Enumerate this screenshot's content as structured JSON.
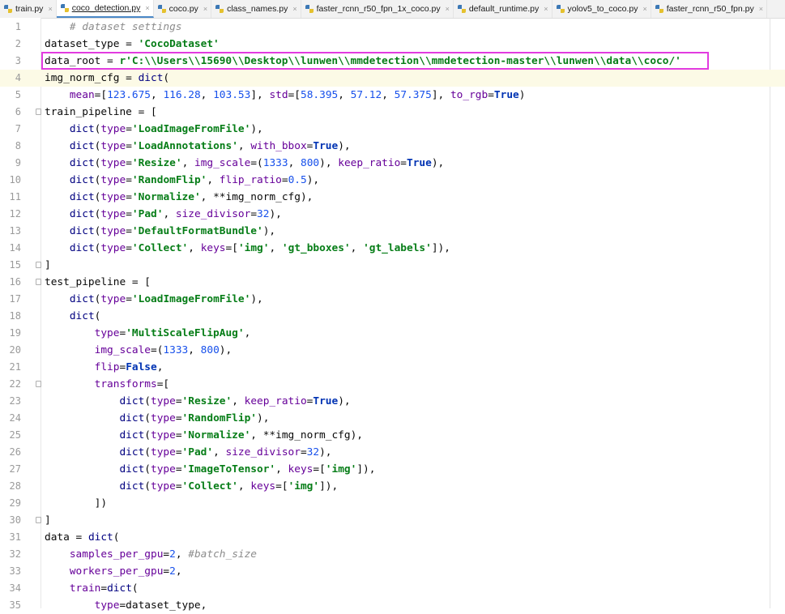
{
  "tabs": [
    {
      "label": "train.py",
      "active": false
    },
    {
      "label": "coco_detection.py",
      "active": true
    },
    {
      "label": "coco.py",
      "active": false
    },
    {
      "label": "class_names.py",
      "active": false
    },
    {
      "label": "faster_rcnn_r50_fpn_1x_coco.py",
      "active": false
    },
    {
      "label": "default_runtime.py",
      "active": false
    },
    {
      "label": "yolov5_to_coco.py",
      "active": false
    },
    {
      "label": "faster_rcnn_r50_fpn.py",
      "active": false
    }
  ],
  "tab_close_glyph": "×",
  "editor": {
    "current_line": 4,
    "highlighted_line": 3,
    "lines": [
      {
        "n": "1",
        "fold": false,
        "tokens": [
          [
            "    ",
            "plain"
          ],
          [
            "# dataset settings",
            "cm"
          ]
        ]
      },
      {
        "n": "2",
        "fold": false,
        "tokens": [
          [
            "dataset_type = ",
            "plain"
          ],
          [
            "'CocoDataset'",
            "str"
          ]
        ]
      },
      {
        "n": "3",
        "fold": false,
        "tokens": [
          [
            "data_root = ",
            "plain"
          ],
          [
            "r'C:\\\\Users\\\\15690\\\\Desktop\\\\lunwen\\\\mmdetection\\\\mmdetection-master\\\\lunwen\\\\data\\\\coco/'",
            "str"
          ]
        ]
      },
      {
        "n": "4",
        "fold": false,
        "tokens": [
          [
            "img_norm_cfg = ",
            "plain"
          ],
          [
            "dict",
            "fn"
          ],
          [
            "(",
            "plain"
          ]
        ]
      },
      {
        "n": "5",
        "fold": false,
        "tokens": [
          [
            "    ",
            "plain"
          ],
          [
            "mean",
            "kwarg"
          ],
          [
            "=[",
            "plain"
          ],
          [
            "123.675",
            "num"
          ],
          [
            ", ",
            "plain"
          ],
          [
            "116.28",
            "num"
          ],
          [
            ", ",
            "plain"
          ],
          [
            "103.53",
            "num"
          ],
          [
            "], ",
            "plain"
          ],
          [
            "std",
            "kwarg"
          ],
          [
            "=[",
            "plain"
          ],
          [
            "58.395",
            "num"
          ],
          [
            ", ",
            "plain"
          ],
          [
            "57.12",
            "num"
          ],
          [
            ", ",
            "plain"
          ],
          [
            "57.375",
            "num"
          ],
          [
            "], ",
            "plain"
          ],
          [
            "to_rgb",
            "kwarg"
          ],
          [
            "=",
            "plain"
          ],
          [
            "True",
            "kw"
          ],
          [
            ")",
            "plain"
          ]
        ]
      },
      {
        "n": "6",
        "fold": true,
        "tokens": [
          [
            "train_pipeline = [",
            "plain"
          ]
        ]
      },
      {
        "n": "7",
        "fold": false,
        "tokens": [
          [
            "    ",
            "plain"
          ],
          [
            "dict",
            "fn"
          ],
          [
            "(",
            "plain"
          ],
          [
            "type",
            "kwarg"
          ],
          [
            "=",
            "plain"
          ],
          [
            "'LoadImageFromFile'",
            "str"
          ],
          [
            "),",
            "plain"
          ]
        ]
      },
      {
        "n": "8",
        "fold": false,
        "tokens": [
          [
            "    ",
            "plain"
          ],
          [
            "dict",
            "fn"
          ],
          [
            "(",
            "plain"
          ],
          [
            "type",
            "kwarg"
          ],
          [
            "=",
            "plain"
          ],
          [
            "'LoadAnnotations'",
            "str"
          ],
          [
            ", ",
            "plain"
          ],
          [
            "with_bbox",
            "kwarg"
          ],
          [
            "=",
            "plain"
          ],
          [
            "True",
            "kw"
          ],
          [
            "),",
            "plain"
          ]
        ]
      },
      {
        "n": "9",
        "fold": false,
        "tokens": [
          [
            "    ",
            "plain"
          ],
          [
            "dict",
            "fn"
          ],
          [
            "(",
            "plain"
          ],
          [
            "type",
            "kwarg"
          ],
          [
            "=",
            "plain"
          ],
          [
            "'Resize'",
            "str"
          ],
          [
            ", ",
            "plain"
          ],
          [
            "img_scale",
            "kwarg"
          ],
          [
            "=(",
            "plain"
          ],
          [
            "1333",
            "num"
          ],
          [
            ", ",
            "plain"
          ],
          [
            "800",
            "num"
          ],
          [
            "), ",
            "plain"
          ],
          [
            "keep_ratio",
            "kwarg"
          ],
          [
            "=",
            "plain"
          ],
          [
            "True",
            "kw"
          ],
          [
            "),",
            "plain"
          ]
        ]
      },
      {
        "n": "10",
        "fold": false,
        "tokens": [
          [
            "    ",
            "plain"
          ],
          [
            "dict",
            "fn"
          ],
          [
            "(",
            "plain"
          ],
          [
            "type",
            "kwarg"
          ],
          [
            "=",
            "plain"
          ],
          [
            "'RandomFlip'",
            "str"
          ],
          [
            ", ",
            "plain"
          ],
          [
            "flip_ratio",
            "kwarg"
          ],
          [
            "=",
            "plain"
          ],
          [
            "0.5",
            "num"
          ],
          [
            "),",
            "plain"
          ]
        ]
      },
      {
        "n": "11",
        "fold": false,
        "tokens": [
          [
            "    ",
            "plain"
          ],
          [
            "dict",
            "fn"
          ],
          [
            "(",
            "plain"
          ],
          [
            "type",
            "kwarg"
          ],
          [
            "=",
            "plain"
          ],
          [
            "'Normalize'",
            "str"
          ],
          [
            ", **img_norm_cfg),",
            "plain"
          ]
        ]
      },
      {
        "n": "12",
        "fold": false,
        "tokens": [
          [
            "    ",
            "plain"
          ],
          [
            "dict",
            "fn"
          ],
          [
            "(",
            "plain"
          ],
          [
            "type",
            "kwarg"
          ],
          [
            "=",
            "plain"
          ],
          [
            "'Pad'",
            "str"
          ],
          [
            ", ",
            "plain"
          ],
          [
            "size_divisor",
            "kwarg"
          ],
          [
            "=",
            "plain"
          ],
          [
            "32",
            "num"
          ],
          [
            "),",
            "plain"
          ]
        ]
      },
      {
        "n": "13",
        "fold": false,
        "tokens": [
          [
            "    ",
            "plain"
          ],
          [
            "dict",
            "fn"
          ],
          [
            "(",
            "plain"
          ],
          [
            "type",
            "kwarg"
          ],
          [
            "=",
            "plain"
          ],
          [
            "'DefaultFormatBundle'",
            "str"
          ],
          [
            "),",
            "plain"
          ]
        ]
      },
      {
        "n": "14",
        "fold": false,
        "tokens": [
          [
            "    ",
            "plain"
          ],
          [
            "dict",
            "fn"
          ],
          [
            "(",
            "plain"
          ],
          [
            "type",
            "kwarg"
          ],
          [
            "=",
            "plain"
          ],
          [
            "'Collect'",
            "str"
          ],
          [
            ", ",
            "plain"
          ],
          [
            "keys",
            "kwarg"
          ],
          [
            "=[",
            "plain"
          ],
          [
            "'img'",
            "str"
          ],
          [
            ", ",
            "plain"
          ],
          [
            "'gt_bboxes'",
            "str"
          ],
          [
            ", ",
            "plain"
          ],
          [
            "'gt_labels'",
            "str"
          ],
          [
            "]),",
            "plain"
          ]
        ]
      },
      {
        "n": "15",
        "fold": true,
        "tokens": [
          [
            "]",
            "plain"
          ]
        ]
      },
      {
        "n": "16",
        "fold": true,
        "tokens": [
          [
            "test_pipeline = [",
            "plain"
          ]
        ]
      },
      {
        "n": "17",
        "fold": false,
        "tokens": [
          [
            "    ",
            "plain"
          ],
          [
            "dict",
            "fn"
          ],
          [
            "(",
            "plain"
          ],
          [
            "type",
            "kwarg"
          ],
          [
            "=",
            "plain"
          ],
          [
            "'LoadImageFromFile'",
            "str"
          ],
          [
            "),",
            "plain"
          ]
        ]
      },
      {
        "n": "18",
        "fold": false,
        "tokens": [
          [
            "    ",
            "plain"
          ],
          [
            "dict",
            "fn"
          ],
          [
            "(",
            "plain"
          ]
        ]
      },
      {
        "n": "19",
        "fold": false,
        "tokens": [
          [
            "        ",
            "plain"
          ],
          [
            "type",
            "kwarg"
          ],
          [
            "=",
            "plain"
          ],
          [
            "'MultiScaleFlipAug'",
            "str"
          ],
          [
            ",",
            "plain"
          ]
        ]
      },
      {
        "n": "20",
        "fold": false,
        "tokens": [
          [
            "        ",
            "plain"
          ],
          [
            "img_scale",
            "kwarg"
          ],
          [
            "=(",
            "plain"
          ],
          [
            "1333",
            "num"
          ],
          [
            ", ",
            "plain"
          ],
          [
            "800",
            "num"
          ],
          [
            "),",
            "plain"
          ]
        ]
      },
      {
        "n": "21",
        "fold": false,
        "tokens": [
          [
            "        ",
            "plain"
          ],
          [
            "flip",
            "kwarg"
          ],
          [
            "=",
            "plain"
          ],
          [
            "False",
            "kw"
          ],
          [
            ",",
            "plain"
          ]
        ]
      },
      {
        "n": "22",
        "fold": true,
        "tokens": [
          [
            "        ",
            "plain"
          ],
          [
            "transforms",
            "kwarg"
          ],
          [
            "=[",
            "plain"
          ]
        ]
      },
      {
        "n": "23",
        "fold": false,
        "tokens": [
          [
            "            ",
            "plain"
          ],
          [
            "dict",
            "fn"
          ],
          [
            "(",
            "plain"
          ],
          [
            "type",
            "kwarg"
          ],
          [
            "=",
            "plain"
          ],
          [
            "'Resize'",
            "str"
          ],
          [
            ", ",
            "plain"
          ],
          [
            "keep_ratio",
            "kwarg"
          ],
          [
            "=",
            "plain"
          ],
          [
            "True",
            "kw"
          ],
          [
            "),",
            "plain"
          ]
        ]
      },
      {
        "n": "24",
        "fold": false,
        "tokens": [
          [
            "            ",
            "plain"
          ],
          [
            "dict",
            "fn"
          ],
          [
            "(",
            "plain"
          ],
          [
            "type",
            "kwarg"
          ],
          [
            "=",
            "plain"
          ],
          [
            "'RandomFlip'",
            "str"
          ],
          [
            "),",
            "plain"
          ]
        ]
      },
      {
        "n": "25",
        "fold": false,
        "tokens": [
          [
            "            ",
            "plain"
          ],
          [
            "dict",
            "fn"
          ],
          [
            "(",
            "plain"
          ],
          [
            "type",
            "kwarg"
          ],
          [
            "=",
            "plain"
          ],
          [
            "'Normalize'",
            "str"
          ],
          [
            ", **img_norm_cfg),",
            "plain"
          ]
        ]
      },
      {
        "n": "26",
        "fold": false,
        "tokens": [
          [
            "            ",
            "plain"
          ],
          [
            "dict",
            "fn"
          ],
          [
            "(",
            "plain"
          ],
          [
            "type",
            "kwarg"
          ],
          [
            "=",
            "plain"
          ],
          [
            "'Pad'",
            "str"
          ],
          [
            ", ",
            "plain"
          ],
          [
            "size_divisor",
            "kwarg"
          ],
          [
            "=",
            "plain"
          ],
          [
            "32",
            "num"
          ],
          [
            "),",
            "plain"
          ]
        ]
      },
      {
        "n": "27",
        "fold": false,
        "tokens": [
          [
            "            ",
            "plain"
          ],
          [
            "dict",
            "fn"
          ],
          [
            "(",
            "plain"
          ],
          [
            "type",
            "kwarg"
          ],
          [
            "=",
            "plain"
          ],
          [
            "'ImageToTensor'",
            "str"
          ],
          [
            ", ",
            "plain"
          ],
          [
            "keys",
            "kwarg"
          ],
          [
            "=[",
            "plain"
          ],
          [
            "'img'",
            "str"
          ],
          [
            "]),",
            "plain"
          ]
        ]
      },
      {
        "n": "28",
        "fold": false,
        "tokens": [
          [
            "            ",
            "plain"
          ],
          [
            "dict",
            "fn"
          ],
          [
            "(",
            "plain"
          ],
          [
            "type",
            "kwarg"
          ],
          [
            "=",
            "plain"
          ],
          [
            "'Collect'",
            "str"
          ],
          [
            ", ",
            "plain"
          ],
          [
            "keys",
            "kwarg"
          ],
          [
            "=[",
            "plain"
          ],
          [
            "'img'",
            "str"
          ],
          [
            "]),",
            "plain"
          ]
        ]
      },
      {
        "n": "29",
        "fold": false,
        "tokens": [
          [
            "        ])",
            "plain"
          ]
        ]
      },
      {
        "n": "30",
        "fold": true,
        "tokens": [
          [
            "]",
            "plain"
          ]
        ]
      },
      {
        "n": "31",
        "fold": false,
        "tokens": [
          [
            "data = ",
            "plain"
          ],
          [
            "dict",
            "fn"
          ],
          [
            "(",
            "plain"
          ]
        ]
      },
      {
        "n": "32",
        "fold": false,
        "tokens": [
          [
            "    ",
            "plain"
          ],
          [
            "samples_per_gpu",
            "kwarg"
          ],
          [
            "=",
            "plain"
          ],
          [
            "2",
            "num"
          ],
          [
            ", ",
            "plain"
          ],
          [
            "#batch_size",
            "cm"
          ]
        ]
      },
      {
        "n": "33",
        "fold": false,
        "tokens": [
          [
            "    ",
            "plain"
          ],
          [
            "workers_per_gpu",
            "kwarg"
          ],
          [
            "=",
            "plain"
          ],
          [
            "2",
            "num"
          ],
          [
            ",",
            "plain"
          ]
        ]
      },
      {
        "n": "34",
        "fold": false,
        "tokens": [
          [
            "    ",
            "plain"
          ],
          [
            "train",
            "kwarg"
          ],
          [
            "=",
            "plain"
          ],
          [
            "dict",
            "fn"
          ],
          [
            "(",
            "plain"
          ]
        ]
      },
      {
        "n": "35",
        "fold": false,
        "tokens": [
          [
            "        ",
            "plain"
          ],
          [
            "type",
            "kwarg"
          ],
          [
            "=dataset_type,",
            "plain"
          ]
        ]
      }
    ]
  }
}
